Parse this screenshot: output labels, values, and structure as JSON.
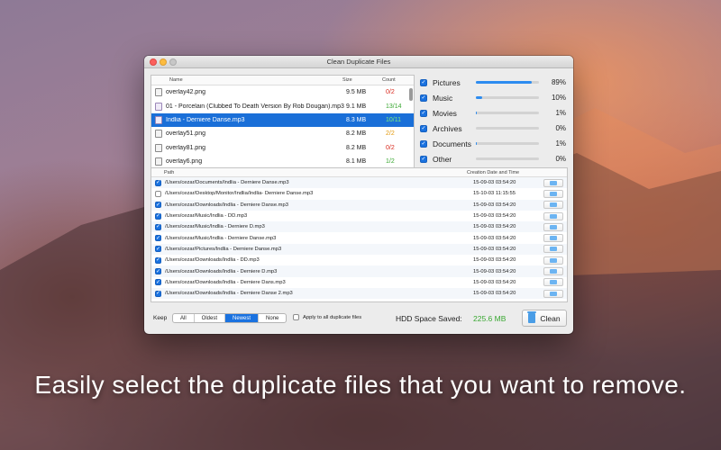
{
  "window": {
    "title": "Clean Duplicate Files"
  },
  "filelist": {
    "headers": {
      "name": "Name",
      "size": "Size",
      "count": "Count"
    },
    "rows": [
      {
        "name": "overlay42.png",
        "size": "9.5 MB",
        "count": "0/2",
        "count_color": "red",
        "icon": "image-file-icon",
        "selected": false
      },
      {
        "name": "01 - Porcelain (Clubbed To Death Version By Rob Dougan).mp3",
        "size": "9.1 MB",
        "count": "13/14",
        "count_color": "green",
        "icon": "music-file-icon",
        "selected": false
      },
      {
        "name": "Indlia - Derniere Danse.mp3",
        "size": "8.3 MB",
        "count": "10/11",
        "count_color": "green",
        "icon": "music-file-icon",
        "selected": true
      },
      {
        "name": "overlay51.png",
        "size": "8.2 MB",
        "count": "2/2",
        "count_color": "orange",
        "icon": "image-file-icon",
        "selected": false
      },
      {
        "name": "overlay81.png",
        "size": "8.2 MB",
        "count": "0/2",
        "count_color": "red",
        "icon": "image-file-icon",
        "selected": false
      },
      {
        "name": "overlay6.png",
        "size": "8.1 MB",
        "count": "1/2",
        "count_color": "green",
        "icon": "image-file-icon",
        "selected": false
      }
    ]
  },
  "categories": [
    {
      "name": "Pictures",
      "percent": "89%",
      "fill": 0.89,
      "checked": true
    },
    {
      "name": "Music",
      "percent": "10%",
      "fill": 0.1,
      "checked": true
    },
    {
      "name": "Movies",
      "percent": "1%",
      "fill": 0.01,
      "checked": true
    },
    {
      "name": "Archives",
      "percent": "0%",
      "fill": 0.0,
      "checked": true
    },
    {
      "name": "Documents",
      "percent": "1%",
      "fill": 0.01,
      "checked": true
    },
    {
      "name": "Other",
      "percent": "0%",
      "fill": 0.0,
      "checked": true
    }
  ],
  "paths": {
    "headers": {
      "path": "Path",
      "date": "Creation Date and Time"
    },
    "rows": [
      {
        "path": "/Users/cezar/Documents/Indlia - Derniere Danse.mp3",
        "date": "15-09-03 03:54:20",
        "checked": true
      },
      {
        "path": "/Users/cezar/Desktop/Monitor/Indlia/Indlia- Derniere Danse.mp3",
        "date": "15-10-03 11:15:55",
        "checked": false
      },
      {
        "path": "/Users/cezar/Downloads/Indlia - Derniere Danse.mp3",
        "date": "15-09-03 03:54:20",
        "checked": true
      },
      {
        "path": "/Users/cezar/Music/Indlia - DD.mp3",
        "date": "15-09-03 03:54:20",
        "checked": true
      },
      {
        "path": "/Users/cezar/Music/Indlia - Derniere D.mp3",
        "date": "15-09-03 03:54:20",
        "checked": true
      },
      {
        "path": "/Users/cezar/Music/Indlia - Derniere Danse.mp3",
        "date": "15-09-03 03:54:20",
        "checked": true
      },
      {
        "path": "/Users/cezar/Pictures/Indlia - Derniere Danse.mp3",
        "date": "15-09-03 03:54:20",
        "checked": true
      },
      {
        "path": "/Users/cezar/Downloads/Indlia - DD.mp3",
        "date": "15-09-03 03:54:20",
        "checked": true
      },
      {
        "path": "/Users/cezar/Downloads/Indlia - Derniere D.mp3",
        "date": "15-09-03 03:54:20",
        "checked": true
      },
      {
        "path": "/Users/cezar/Downloads/Indlia - Derniere Dans.mp3",
        "date": "15-09-03 03:54:20",
        "checked": true
      },
      {
        "path": "/Users/cezar/Downloads/Indlia - Derniere Danse 2.mp3",
        "date": "15-09-03 03:54:20",
        "checked": true
      }
    ]
  },
  "bottom": {
    "keep_label": "Keep",
    "keep_options": [
      "All",
      "Oldest",
      "Newest",
      "None"
    ],
    "keep_selected": "Newest",
    "apply_label": "Apply to all duplicate files",
    "hdd_label": "HDD Space Saved:",
    "hdd_value": "225.6 MB",
    "clean_label": "Clean"
  },
  "caption": "Easily select the duplicate files that you want to remove.",
  "colors": {
    "accent": "#1a72e0",
    "progress": "#2d8cf0",
    "green": "#3aa832",
    "red": "#d92b1f",
    "orange": "#e39a10"
  }
}
